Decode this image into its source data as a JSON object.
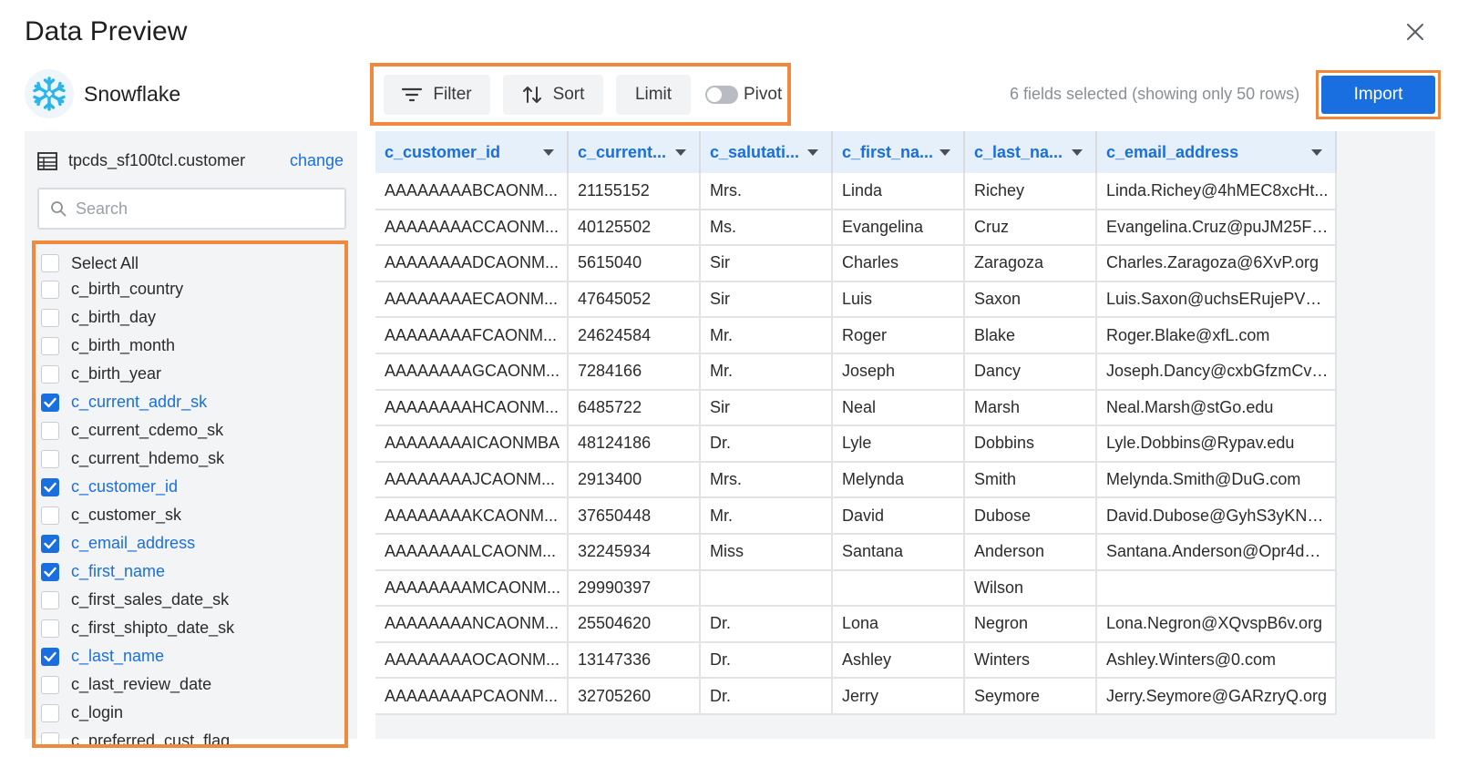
{
  "dialog": {
    "title": "Data Preview"
  },
  "source": {
    "name": "Snowflake"
  },
  "toolbar": {
    "filter_label": "Filter",
    "sort_label": "Sort",
    "limit_label": "Limit",
    "pivot_label": "Pivot",
    "pivot_on": false
  },
  "status_text": "6 fields selected (showing only 50 rows)",
  "import_label": "Import",
  "accent_color": "#1a6fe0",
  "highlight_color": "#f0883e",
  "left_panel": {
    "table_name": "tpcds_sf100tcl.customer",
    "change_label": "change",
    "search_placeholder": "Search",
    "fields": [
      {
        "label": "Select All",
        "checked": false
      },
      {
        "label": "c_birth_country",
        "checked": false
      },
      {
        "label": "c_birth_day",
        "checked": false
      },
      {
        "label": "c_birth_month",
        "checked": false
      },
      {
        "label": "c_birth_year",
        "checked": false
      },
      {
        "label": "c_current_addr_sk",
        "checked": true
      },
      {
        "label": "c_current_cdemo_sk",
        "checked": false
      },
      {
        "label": "c_current_hdemo_sk",
        "checked": false
      },
      {
        "label": "c_customer_id",
        "checked": true
      },
      {
        "label": "c_customer_sk",
        "checked": false
      },
      {
        "label": "c_email_address",
        "checked": true
      },
      {
        "label": "c_first_name",
        "checked": true
      },
      {
        "label": "c_first_sales_date_sk",
        "checked": false
      },
      {
        "label": "c_first_shipto_date_sk",
        "checked": false
      },
      {
        "label": "c_last_name",
        "checked": true
      },
      {
        "label": "c_last_review_date",
        "checked": false
      },
      {
        "label": "c_login",
        "checked": false
      },
      {
        "label": "c_preferred_cust_flag",
        "checked": false
      }
    ]
  },
  "grid": {
    "columns": [
      "c_customer_id",
      "c_current...",
      "c_salutati...",
      "c_first_na...",
      "c_last_na...",
      "c_email_address"
    ],
    "rows": [
      [
        "AAAAAAAABCAONM...",
        "21155152",
        "Mrs.",
        "Linda",
        "Richey",
        "Linda.Richey@4hMEC8xcHt..."
      ],
      [
        "AAAAAAAACCAONM...",
        "40125502",
        "Ms.",
        "Evangelina",
        "Cruz",
        "Evangelina.Cruz@puJM25Ft..."
      ],
      [
        "AAAAAAAADCAONM...",
        "5615040",
        "Sir",
        "Charles",
        "Zaragoza",
        "Charles.Zaragoza@6XvP.org"
      ],
      [
        "AAAAAAAAECAONM...",
        "47645052",
        "Sir",
        "Luis",
        "Saxon",
        "Luis.Saxon@uchsERujePVO..."
      ],
      [
        "AAAAAAAAFCAONM...",
        "24624584",
        "Mr.",
        "Roger",
        "Blake",
        "Roger.Blake@xfL.com"
      ],
      [
        "AAAAAAAAGCAONM...",
        "7284166",
        "Mr.",
        "Joseph",
        "Dancy",
        "Joseph.Dancy@cxbGfzmCvJ..."
      ],
      [
        "AAAAAAAAHCAONM...",
        "6485722",
        "Sir",
        "Neal",
        "Marsh",
        "Neal.Marsh@stGo.edu"
      ],
      [
        "AAAAAAAAICAONMBA",
        "48124186",
        "Dr.",
        "Lyle",
        "Dobbins",
        "Lyle.Dobbins@Rypav.edu"
      ],
      [
        "AAAAAAAAJCAONM...",
        "2913400",
        "Mrs.",
        "Melynda",
        "Smith",
        "Melynda.Smith@DuG.com"
      ],
      [
        "AAAAAAAAKCAONM...",
        "37650448",
        "Mr.",
        "David",
        "Dubose",
        "David.Dubose@GyhS3yKNH..."
      ],
      [
        "AAAAAAAALCAONM...",
        "32245934",
        "Miss",
        "Santana",
        "Anderson",
        "Santana.Anderson@Opr4dQ..."
      ],
      [
        "AAAAAAAAMCAONM...",
        "29990397",
        "",
        "",
        "Wilson",
        ""
      ],
      [
        "AAAAAAAANCAONM...",
        "25504620",
        "Dr.",
        "Lona",
        "Negron",
        "Lona.Negron@XQvspB6v.org"
      ],
      [
        "AAAAAAAAOCAONM...",
        "13147336",
        "Dr.",
        "Ashley",
        "Winters",
        "Ashley.Winters@0.com"
      ],
      [
        "AAAAAAAAPCAONM...",
        "32705260",
        "Dr.",
        "Jerry",
        "Seymore",
        "Jerry.Seymore@GARzryQ.org"
      ]
    ]
  }
}
